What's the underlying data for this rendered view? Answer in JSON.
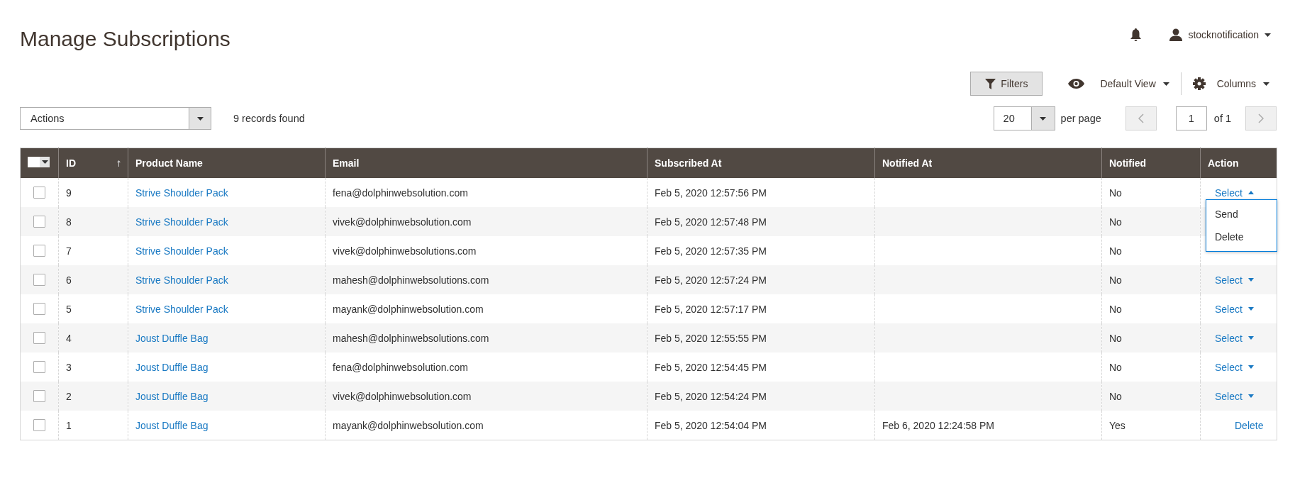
{
  "page": {
    "title": "Manage Subscriptions"
  },
  "header": {
    "user": "stocknotification"
  },
  "toolbar": {
    "filters": "Filters",
    "view": "Default View",
    "columns": "Columns"
  },
  "actions": {
    "label": "Actions",
    "records": "9 records found"
  },
  "pager": {
    "per_page_value": "20",
    "per_page_label": "per page",
    "page": "1",
    "of": "of 1"
  },
  "table": {
    "select_all": {
      "checked": false
    },
    "columns": [
      "ID",
      "Product Name",
      "Email",
      "Subscribed At",
      "Notified At",
      "Notified",
      "Action"
    ],
    "rows": [
      {
        "checked": false,
        "id": "9",
        "product": "Strive Shoulder Pack",
        "email": "fena@dolphinwebsolution.com",
        "subscribed": "Feb 5, 2020 12:57:56 PM",
        "notified_at": "",
        "notified": "No",
        "action": {
          "kind": "select",
          "label": "Select",
          "expanded": true,
          "options": [
            "Send",
            "Delete"
          ]
        }
      },
      {
        "checked": false,
        "id": "8",
        "product": "Strive Shoulder Pack",
        "email": "vivek@dolphinwebsolution.com",
        "subscribed": "Feb 5, 2020 12:57:48 PM",
        "notified_at": "",
        "notified": "No",
        "action": {
          "kind": "hidden"
        }
      },
      {
        "checked": false,
        "id": "7",
        "product": "Strive Shoulder Pack",
        "email": "vivek@dolphinwebsolutions.com",
        "subscribed": "Feb 5, 2020 12:57:35 PM",
        "notified_at": "",
        "notified": "No",
        "action": {
          "kind": "hidden"
        }
      },
      {
        "checked": false,
        "id": "6",
        "product": "Strive Shoulder Pack",
        "email": "mahesh@dolphinwebsolutions.com",
        "subscribed": "Feb 5, 2020 12:57:24 PM",
        "notified_at": "",
        "notified": "No",
        "action": {
          "kind": "select",
          "label": "Select",
          "expanded": false
        }
      },
      {
        "checked": false,
        "id": "5",
        "product": "Strive Shoulder Pack",
        "email": "mayank@dolphinwebsolution.com",
        "subscribed": "Feb 5, 2020 12:57:17 PM",
        "notified_at": "",
        "notified": "No",
        "action": {
          "kind": "select",
          "label": "Select",
          "expanded": false
        }
      },
      {
        "checked": false,
        "id": "4",
        "product": "Joust Duffle Bag",
        "email": "mahesh@dolphinwebsolutions.com",
        "subscribed": "Feb 5, 2020 12:55:55 PM",
        "notified_at": "",
        "notified": "No",
        "action": {
          "kind": "select",
          "label": "Select",
          "expanded": false
        }
      },
      {
        "checked": false,
        "id": "3",
        "product": "Joust Duffle Bag",
        "email": "fena@dolphinwebsolution.com",
        "subscribed": "Feb 5, 2020 12:54:45 PM",
        "notified_at": "",
        "notified": "No",
        "action": {
          "kind": "select",
          "label": "Select",
          "expanded": false
        }
      },
      {
        "checked": false,
        "id": "2",
        "product": "Joust Duffle Bag",
        "email": "vivek@dolphinwebsolution.com",
        "subscribed": "Feb 5, 2020 12:54:24 PM",
        "notified_at": "",
        "notified": "No",
        "action": {
          "kind": "select",
          "label": "Select",
          "expanded": false
        }
      },
      {
        "checked": false,
        "id": "1",
        "product": "Joust Duffle Bag",
        "email": "mayank@dolphinwebsolution.com",
        "subscribed": "Feb 5, 2020 12:54:04 PM",
        "notified_at": "Feb 6, 2020 12:24:58 PM",
        "notified": "Yes",
        "action": {
          "kind": "link",
          "label": "Delete"
        }
      }
    ]
  }
}
